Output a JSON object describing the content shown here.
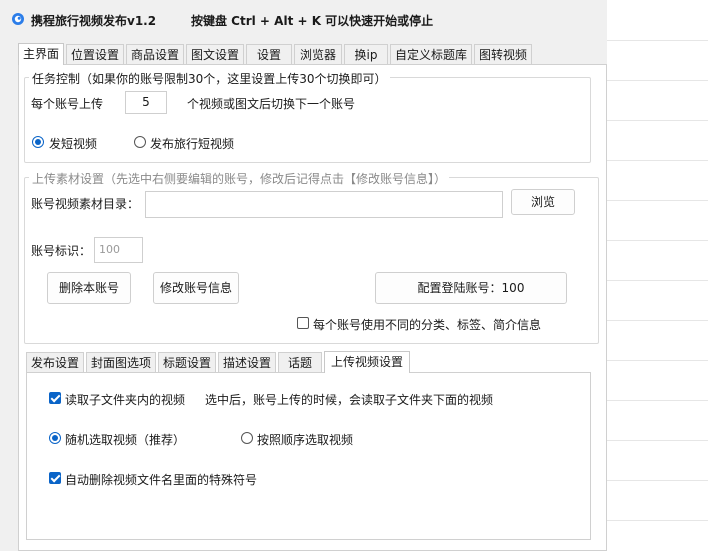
{
  "window": {
    "title": "携程旅行视频发布v1.2",
    "hint": "按键盘 Ctrl + Alt + K  可以快速开始或停止"
  },
  "main_tabs": [
    {
      "label": "主界面",
      "active": true
    },
    {
      "label": "位置设置",
      "active": false
    },
    {
      "label": "商品设置",
      "active": false
    },
    {
      "label": "图文设置",
      "active": false
    },
    {
      "label": "设置",
      "active": false
    },
    {
      "label": "浏览器",
      "active": false
    },
    {
      "label": "换ip",
      "active": false
    },
    {
      "label": "自定义标题库",
      "active": false
    },
    {
      "label": "图转视频",
      "active": false
    }
  ],
  "task_control": {
    "title": "任务控制（如果你的账号限制30个，这里设置上传30个切换即可）",
    "per_account_label": "每个账号上传",
    "per_account_value": "5",
    "switch_label": "个视频或图文后切换下一个账号",
    "radio_short": "发短视频",
    "radio_travel": "发布旅行短视频",
    "selected": "short"
  },
  "upload_settings": {
    "title": "上传素材设置（先选中右侧要编辑的账号，修改后记得点击【修改账号信息】）",
    "dir_label": "账号视频素材目录：",
    "dir_value": "",
    "browse_button": "浏览",
    "account_id_label": "账号标识：",
    "account_id_placeholder": "100",
    "delete_button": "删除本账号",
    "modify_button": "修改账号信息",
    "login_button": "配置登陆账号：100",
    "diff_checkbox_label": "每个账号使用不同的分类、标签、简介信息",
    "diff_checked": false
  },
  "sub_tabs": [
    {
      "label": "发布设置",
      "active": false
    },
    {
      "label": "封面图选项",
      "active": false
    },
    {
      "label": "标题设置",
      "active": false
    },
    {
      "label": "描述设置",
      "active": false
    },
    {
      "label": "话题",
      "active": false
    },
    {
      "label": "上传视频设置",
      "active": true
    }
  ],
  "upload_video": {
    "read_subfolder_label": "读取子文件夹内的视频",
    "read_subfolder_checked": true,
    "read_subfolder_desc": "选中后，账号上传的时候，会读取子文件夹下面的视频",
    "random_label": "随机选取视频（推荐）",
    "order_label": "按照顺序选取视频",
    "selection": "random",
    "auto_delete_label": "自动删除视频文件名里面的特殊符号",
    "auto_delete_checked": true
  },
  "colors": {
    "accent": "#0a64c8",
    "window_bg": "#f0f0f0",
    "panel_bg": "#ffffff"
  },
  "icons": {
    "app": "app-logo-icon"
  }
}
